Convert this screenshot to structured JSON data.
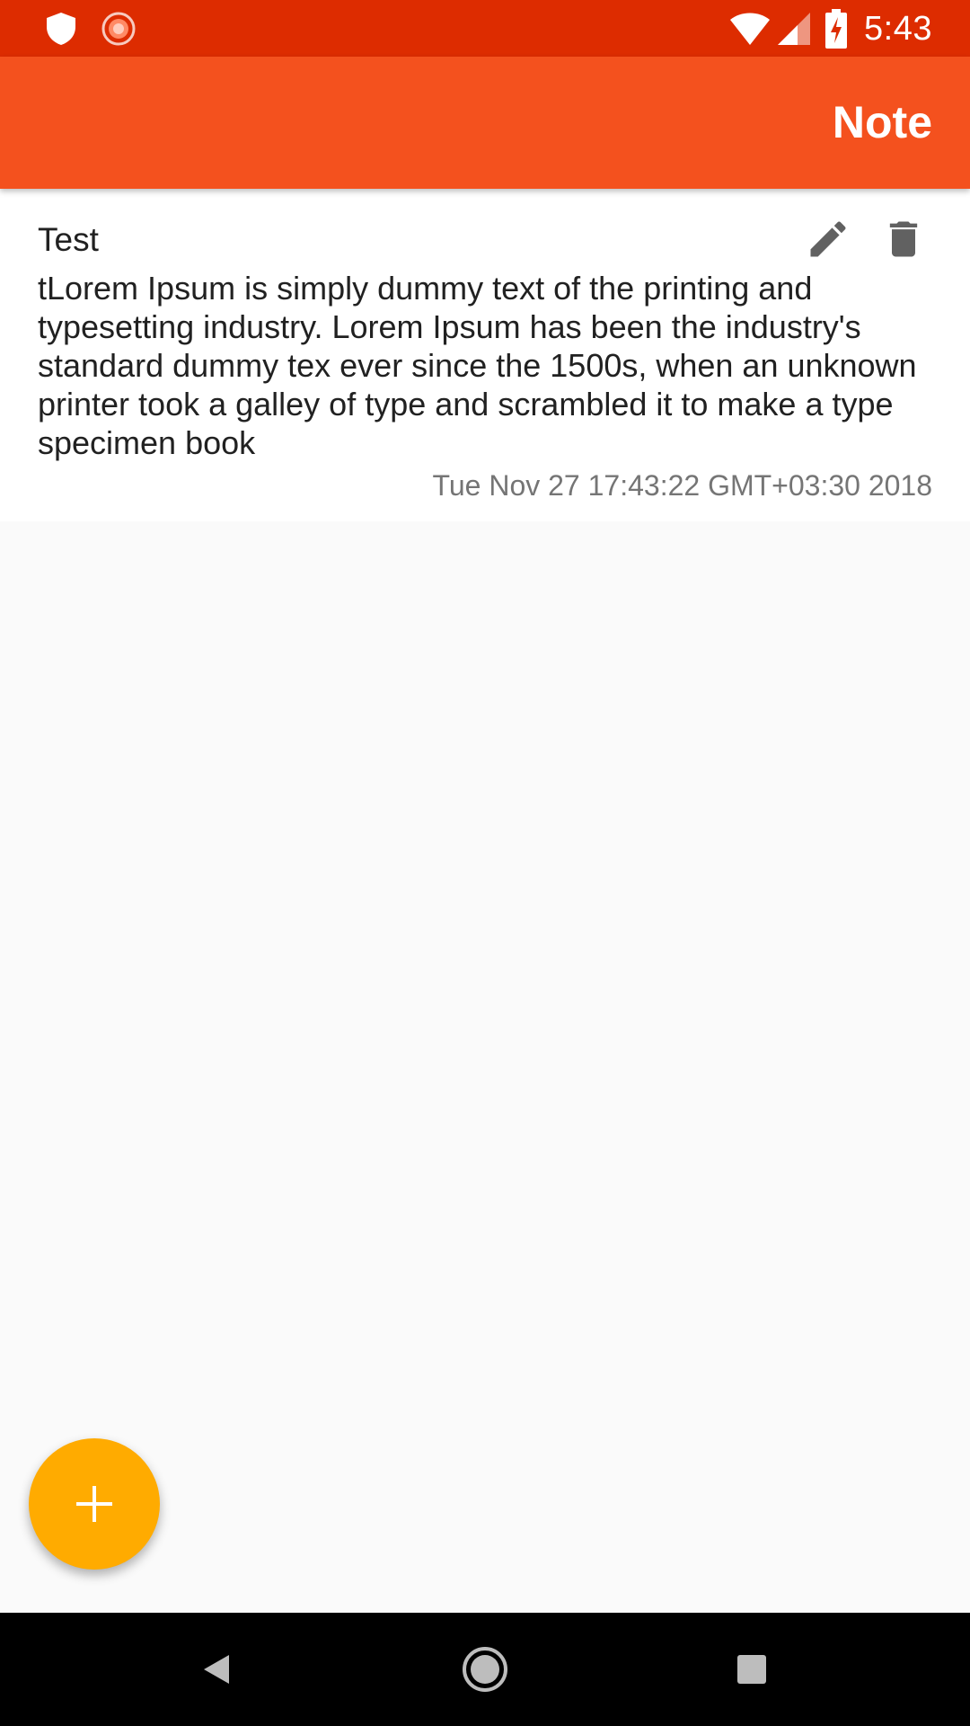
{
  "status_bar": {
    "time": "5:43",
    "left_icons": [
      "shield-icon",
      "sync-progress-icon"
    ],
    "right_icons": [
      "wifi-icon",
      "cell-signal-icon",
      "battery-charging-icon"
    ]
  },
  "app_bar": {
    "title": "Note"
  },
  "notes": [
    {
      "title": "Test",
      "body": "tLorem Ipsum is simply dummy text of the printing and typesetting industry. Lorem Ipsum has been the industry's standard dummy tex ever since the 1500s, when an unknown printer took a galley of type and scrambled it to make a type specimen book",
      "date": "Tue Nov 27 17:43:22 GMT+03:30 2018",
      "actions": [
        "pencil-icon",
        "trash-icon"
      ]
    }
  ],
  "fab": {
    "icon": "plus-icon"
  },
  "nav_bar": {
    "buttons": [
      "back-icon",
      "home-icon",
      "recents-icon"
    ]
  },
  "colors": {
    "status_bar": "#dd2c00",
    "app_bar": "#f4511e",
    "fab": "#ffab00",
    "background": "#fafafa",
    "icon_gray": "#616161"
  }
}
